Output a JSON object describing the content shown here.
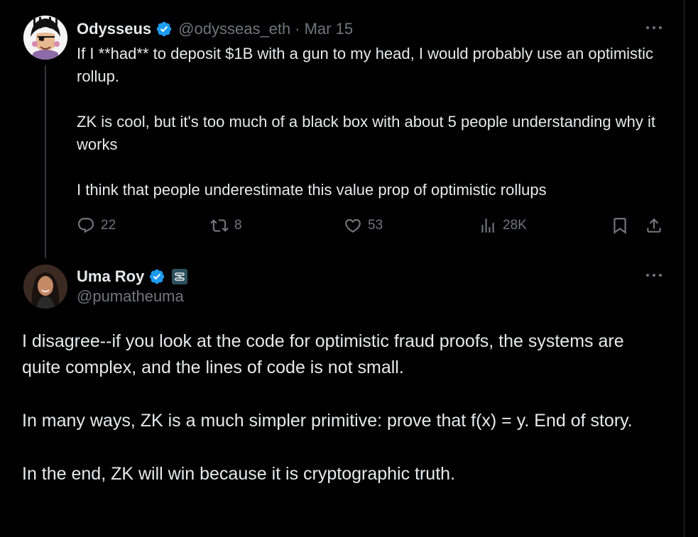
{
  "tweet1": {
    "author_name": "Odysseus",
    "handle": "@odysseas_eth",
    "separator": "·",
    "date": "Mar 15",
    "paragraphs": [
      "If I **had** to deposit $1B with a gun to my head, I would probably use an optimistic rollup.",
      "ZK is cool, but it's too much of a black box with about 5 people understanding why it works",
      "I think that people underestimate this value prop of optimistic rollups"
    ],
    "actions": {
      "replies": "22",
      "reposts": "8",
      "likes": "53",
      "views": "28K"
    }
  },
  "tweet2": {
    "author_name": "Uma Roy",
    "handle": "@pumatheuma",
    "paragraphs": [
      "I disagree--if you look at the code for optimistic fraud proofs, the systems are quite complex, and the lines of code is not small.",
      "In many ways, ZK is a much simpler primitive: prove that f(x) = y. End of story.",
      "In the end, ZK will win because it is cryptographic truth."
    ]
  },
  "icons": {
    "verified": "verified-badge-icon",
    "more": "more-icon",
    "reply": "reply-icon",
    "repost": "repost-icon",
    "like": "like-icon",
    "views": "views-icon",
    "bookmark": "bookmark-icon",
    "share": "share-icon",
    "affiliate": "affiliate-badge-icon"
  },
  "colors": {
    "background": "#000000",
    "text": "#e7e9ea",
    "muted": "#71767b",
    "verified": "#1d9bf0",
    "divider": "#2f3336"
  }
}
